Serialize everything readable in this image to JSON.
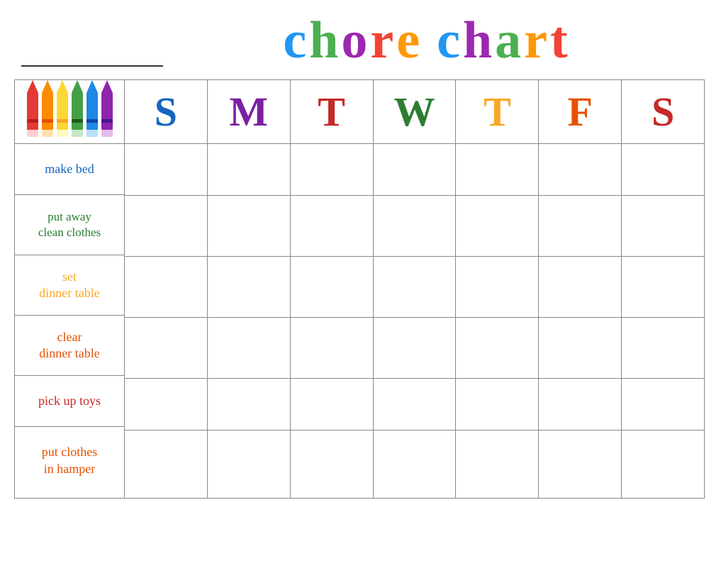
{
  "header": {
    "title_letters_word1": [
      "c",
      "h",
      "o",
      "r",
      "e"
    ],
    "title_letters_word2": [
      "c",
      "h",
      "a",
      "r",
      "t"
    ],
    "title_colors_word1": [
      "#1565C0",
      "#2E7D32",
      "#7B1FA2",
      "#C62828",
      "#E65100"
    ],
    "title_colors_word2": [
      "#1565C0",
      "#7B1FA2",
      "#2E7D32",
      "#E65100",
      "#C62828"
    ]
  },
  "crayons": [
    {
      "color": "#E53935",
      "label": "red"
    },
    {
      "color": "#FB8C00",
      "label": "orange"
    },
    {
      "color": "#FDD835",
      "label": "yellow"
    },
    {
      "color": "#43A047",
      "label": "green"
    },
    {
      "color": "#1E88E5",
      "label": "blue"
    },
    {
      "color": "#8E24AA",
      "label": "purple"
    }
  ],
  "days": {
    "headers": [
      "S",
      "M",
      "T",
      "W",
      "T",
      "F",
      "S"
    ],
    "colors": [
      "#1565C0",
      "#7B1FA2",
      "#C62828",
      "#2E7D32",
      "#F9A825",
      "#E65100",
      "#C62828"
    ]
  },
  "chores": [
    {
      "label": "make bed",
      "color": "#1565C0"
    },
    {
      "label": "put away\nclean clothes",
      "color": "#2E7D32"
    },
    {
      "label": "set\ndinner table",
      "color": "#F9A825"
    },
    {
      "label": "clear\ndinner table",
      "color": "#E65100"
    },
    {
      "label": "pick up toys",
      "color": "#C62828"
    },
    {
      "label": "put clothes\nin hamper",
      "color": "#E65100"
    }
  ]
}
